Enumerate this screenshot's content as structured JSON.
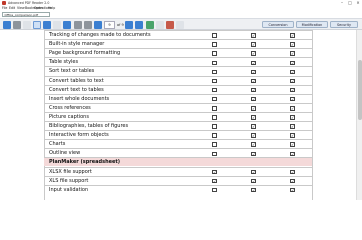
{
  "window": {
    "title": "Advanced PDF Reader 2.0"
  },
  "menu": [
    "File",
    "Edit",
    "View",
    "Bookmarks",
    "Operations",
    "Help"
  ],
  "path": {
    "value": "Office_comparison.pdf"
  },
  "toolbar": {
    "page_current": "9",
    "page_total": "of 9",
    "tabs": [
      "Conversion",
      "Modification",
      "Security"
    ]
  },
  "rows": [
    {
      "label": "Tracking of changes made to documents",
      "section": false,
      "checks": [
        false,
        true,
        true
      ]
    },
    {
      "label": "Built-in style manager",
      "section": false,
      "checks": [
        false,
        true,
        true
      ]
    },
    {
      "label": "Page background formatting",
      "section": false,
      "checks": [
        false,
        true,
        true
      ]
    },
    {
      "label": "Table styles",
      "section": false,
      "checks": [
        false,
        true,
        true
      ]
    },
    {
      "label": "Sort text or tables",
      "section": false,
      "checks": [
        false,
        true,
        true
      ]
    },
    {
      "label": "Convert tables to text",
      "section": false,
      "checks": [
        false,
        true,
        true
      ]
    },
    {
      "label": "Convert text to tables",
      "section": false,
      "checks": [
        false,
        true,
        true
      ]
    },
    {
      "label": "Insert whole documents",
      "section": false,
      "checks": [
        false,
        true,
        true
      ]
    },
    {
      "label": "Cross references",
      "section": false,
      "checks": [
        false,
        true,
        true
      ]
    },
    {
      "label": "Picture captions",
      "section": false,
      "checks": [
        false,
        true,
        true
      ]
    },
    {
      "label": "Bibliographies, tables of figures",
      "section": false,
      "checks": [
        false,
        true,
        true
      ]
    },
    {
      "label": "Interactive form objects",
      "section": false,
      "checks": [
        false,
        true,
        true
      ]
    },
    {
      "label": "Charts",
      "section": false,
      "checks": [
        false,
        true,
        true
      ]
    },
    {
      "label": "Outline view",
      "section": false,
      "checks": [
        false,
        true,
        true
      ]
    },
    {
      "label": "PlanMaker (spreadsheet)",
      "section": true,
      "checks": []
    },
    {
      "label": "XLSX file support",
      "section": false,
      "checks": [
        true,
        true,
        true
      ]
    },
    {
      "label": "XLS file support",
      "section": false,
      "checks": [
        true,
        true,
        true
      ]
    },
    {
      "label": "Input validation",
      "section": false,
      "checks": [
        false,
        true,
        true
      ]
    }
  ],
  "glyphs": {
    "checked": "☑",
    "unchecked": "☐"
  }
}
